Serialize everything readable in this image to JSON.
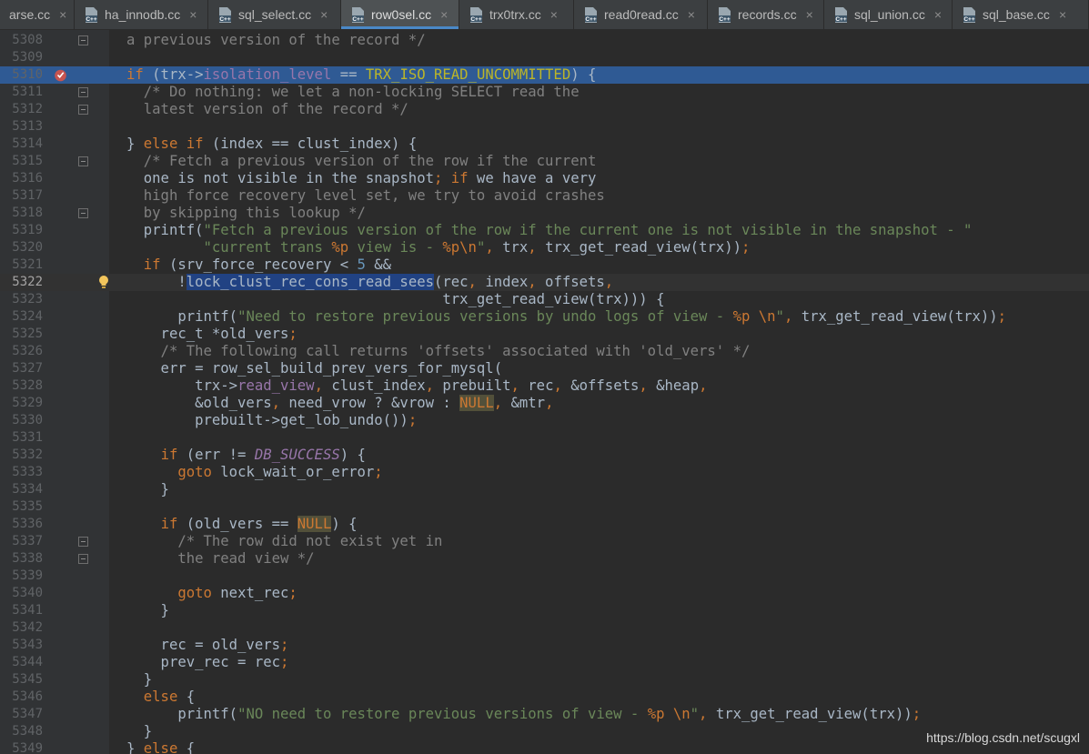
{
  "tabs": [
    {
      "label": "arse.cc",
      "icon": null,
      "active": false,
      "width": 82
    },
    {
      "label": "ha_innodb.cc",
      "icon": "cpp-file-icon",
      "active": false,
      "width": 147
    },
    {
      "label": "sql_select.cc",
      "icon": "cpp-file-icon",
      "active": false,
      "width": 146
    },
    {
      "label": "row0sel.cc",
      "icon": "cpp-file-icon",
      "active": true,
      "width": 130
    },
    {
      "label": "trx0trx.cc",
      "icon": "cpp-file-icon",
      "active": false,
      "width": 126
    },
    {
      "label": "read0read.cc",
      "icon": "cpp-file-icon",
      "active": false,
      "width": 147
    },
    {
      "label": "records.cc",
      "icon": "cpp-file-icon",
      "active": false,
      "width": 128
    },
    {
      "label": "sql_union.cc",
      "icon": "cpp-file-icon",
      "active": false,
      "width": 141
    },
    {
      "label": "sql_base.cc",
      "icon": "cpp-file-icon",
      "active": false,
      "width": 150
    }
  ],
  "tab_close_glyph": "×",
  "editor": {
    "current_line": 5322,
    "highlighted_line": 5310,
    "lines": [
      {
        "n": "5308",
        "c": "a previous version of the record */"
      },
      {
        "n": "5309",
        "c": ""
      },
      {
        "n": "5310",
        "c": "if (trx->isolation_level == TRX_ISO_READ_UNCOMMITTED) {"
      },
      {
        "n": "5311",
        "c": "  /* Do nothing: we let a non-locking SELECT read the"
      },
      {
        "n": "5312",
        "c": "  latest version of the record */"
      },
      {
        "n": "5313",
        "c": ""
      },
      {
        "n": "5314",
        "c": "} else if (index == clust_index) {"
      },
      {
        "n": "5315",
        "c": "  /* Fetch a previous version of the row if the current"
      },
      {
        "n": "5316",
        "c": "  one is not visible in the snapshot; if we have a very"
      },
      {
        "n": "5317",
        "c": "  high force recovery level set, we try to avoid crashes"
      },
      {
        "n": "5318",
        "c": "  by skipping this lookup */"
      },
      {
        "n": "5319",
        "c": "  printf(\"Fetch a previous version of the row if the current one is not visible in the snapshot - \""
      },
      {
        "n": "5320",
        "c": "         \"current trans %p view is - %p\\n\", trx, trx_get_read_view(trx));"
      },
      {
        "n": "5321",
        "c": "  if (srv_force_recovery < 5 &&"
      },
      {
        "n": "5322",
        "c": "      !lock_clust_rec_cons_read_sees(rec, index, offsets,"
      },
      {
        "n": "5323",
        "c": "                                     trx_get_read_view(trx))) {"
      },
      {
        "n": "5324",
        "c": "      printf(\"Need to restore previous versions by undo logs of view - %p \\n\", trx_get_read_view(trx));"
      },
      {
        "n": "5325",
        "c": "    rec_t *old_vers;"
      },
      {
        "n": "5326",
        "c": "    /* The following call returns 'offsets' associated with 'old_vers' */"
      },
      {
        "n": "5327",
        "c": "    err = row_sel_build_prev_vers_for_mysql("
      },
      {
        "n": "5328",
        "c": "        trx->read_view, clust_index, prebuilt, rec, &offsets, &heap,"
      },
      {
        "n": "5329",
        "c": "        &old_vers, need_vrow ? &vrow : NULL, &mtr,"
      },
      {
        "n": "5330",
        "c": "        prebuilt->get_lob_undo());"
      },
      {
        "n": "5331",
        "c": ""
      },
      {
        "n": "5332",
        "c": "    if (err != DB_SUCCESS) {"
      },
      {
        "n": "5333",
        "c": "      goto lock_wait_or_error;"
      },
      {
        "n": "5334",
        "c": "    }"
      },
      {
        "n": "5335",
        "c": ""
      },
      {
        "n": "5336",
        "c": "    if (old_vers == NULL) {"
      },
      {
        "n": "5337",
        "c": "      /* The row did not exist yet in"
      },
      {
        "n": "5338",
        "c": "      the read view */"
      },
      {
        "n": "5339",
        "c": ""
      },
      {
        "n": "5340",
        "c": "      goto next_rec;"
      },
      {
        "n": "5341",
        "c": "    }"
      },
      {
        "n": "5342",
        "c": ""
      },
      {
        "n": "5343",
        "c": "    rec = old_vers;"
      },
      {
        "n": "5344",
        "c": "    prev_rec = rec;"
      },
      {
        "n": "5345",
        "c": "  }"
      },
      {
        "n": "5346",
        "c": "  else {"
      },
      {
        "n": "5347",
        "c": "      printf(\"NO need to restore previous versions of view - %p \\n\", trx_get_read_view(trx));"
      },
      {
        "n": "5348",
        "c": "  }"
      },
      {
        "n": "5349",
        "c": "} else {"
      }
    ]
  },
  "gutter_icons": {
    "breakpoint_line": 5310,
    "intention_bulb_line": 5322,
    "fold_lines": [
      5308,
      5311,
      5312,
      5315,
      5318,
      5337,
      5338
    ]
  },
  "colors": {
    "editor_bg": "#2b2b2b",
    "highlight_line": "#2f5a94",
    "keyword": "#cc7832",
    "field": "#9876aa",
    "string": "#6a8759",
    "comment": "#808080",
    "macro": "#bbb529"
  },
  "watermark": "https://blog.csdn.net/scugxl"
}
